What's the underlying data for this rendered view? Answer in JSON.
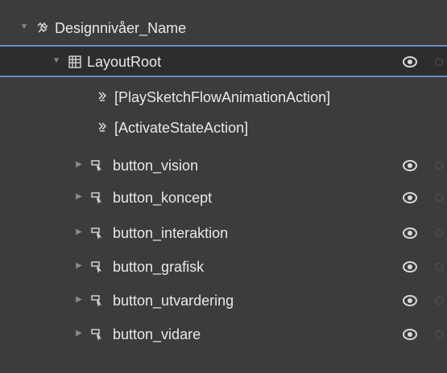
{
  "tree": {
    "root": {
      "label": "Designnivåer_Name",
      "expanded": true,
      "icon": "component-icon"
    },
    "layout_root": {
      "label": "LayoutRoot",
      "expanded": true,
      "icon": "grid-panel-icon",
      "selected": true
    },
    "actions": [
      {
        "label": "[PlaySketchFlowAnimationAction]",
        "icon": "behavior-action-icon"
      },
      {
        "label": "[ActivateStateAction]",
        "icon": "behavior-action-icon"
      }
    ],
    "buttons": [
      {
        "label": "button_vision",
        "icon": "button-control-icon",
        "expanded": false
      },
      {
        "label": "button_koncept",
        "icon": "button-control-icon",
        "expanded": false
      },
      {
        "label": "button_interaktion",
        "icon": "button-control-icon",
        "expanded": false
      },
      {
        "label": "button_grafisk",
        "icon": "button-control-icon",
        "expanded": false
      },
      {
        "label": "button_utvardering",
        "icon": "button-control-icon",
        "expanded": false
      },
      {
        "label": "button_vidare",
        "icon": "button-control-icon",
        "expanded": false
      }
    ]
  },
  "colors": {
    "background": "#3c3c3c",
    "selected_row": "#2d2d2d",
    "selection_border": "#6b8ccc",
    "text": "#e8e8e8",
    "eye": "#d8d8d8",
    "arrow": "#8a8a8a"
  }
}
